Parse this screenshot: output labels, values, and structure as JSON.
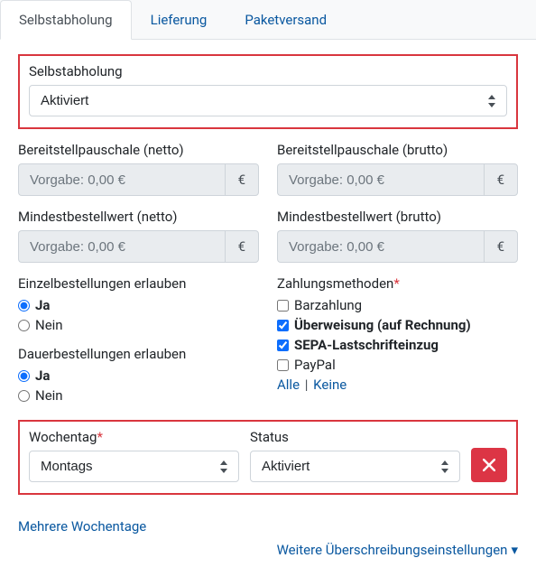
{
  "tabs": [
    {
      "label": "Selbstabholung",
      "active": true
    },
    {
      "label": "Lieferung",
      "active": false
    },
    {
      "label": "Paketversand",
      "active": false
    }
  ],
  "mainSelect": {
    "label": "Selbstabholung",
    "value": "Aktiviert"
  },
  "bpNet": {
    "label": "Bereitstellpauschale (netto)",
    "placeholder": "Vorgabe: 0,00 €",
    "addon": "€"
  },
  "bpGross": {
    "label": "Bereitstellpauschale (brutto)",
    "placeholder": "Vorgabe: 0,00 €",
    "addon": "€"
  },
  "movNet": {
    "label": "Mindestbestellwert (netto)",
    "placeholder": "Vorgabe: 0,00 €",
    "addon": "€"
  },
  "movGross": {
    "label": "Mindestbestellwert (brutto)",
    "placeholder": "Vorgabe: 0,00 €",
    "addon": "€"
  },
  "single": {
    "label": "Einzelbestellungen erlauben",
    "yes": "Ja",
    "no": "Nein"
  },
  "recurring": {
    "label": "Dauerbestellungen erlauben",
    "yes": "Ja",
    "no": "Nein"
  },
  "payments": {
    "label": "Zahlungsmethoden",
    "items": [
      {
        "label": "Barzahlung",
        "checked": false
      },
      {
        "label": "Überweisung (auf Rechnung)",
        "checked": true
      },
      {
        "label": "SEPA-Lastschrifteinzug",
        "checked": true
      },
      {
        "label": "PayPal",
        "checked": false
      }
    ],
    "all": "Alle",
    "none": "Keine"
  },
  "weekday": {
    "label": "Wochentag",
    "value": "Montags"
  },
  "status": {
    "label": "Status",
    "value": "Aktiviert"
  },
  "multipleDays": "Mehrere Wochentage",
  "moreOverrides": "Weitere Überschreibungseinstellungen"
}
